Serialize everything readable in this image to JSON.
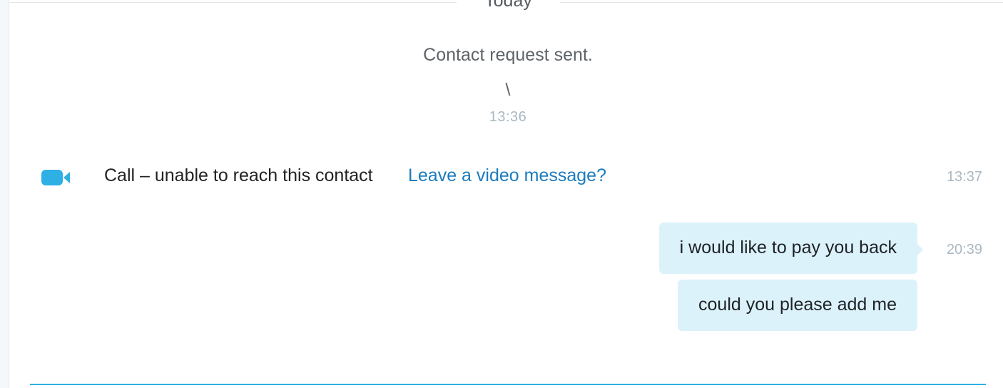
{
  "day_divider": {
    "label": "Today"
  },
  "system_event": {
    "text": "Contact request sent.",
    "sub_text": "\\",
    "time": "13:36"
  },
  "call_event": {
    "icon": "video-camera-icon",
    "text": "Call – unable to reach this contact",
    "link_text": "Leave a video message?",
    "time": "13:37"
  },
  "messages": [
    {
      "text": "i would like to pay you back",
      "time": "20:39"
    },
    {
      "text": "could you please add me"
    }
  ],
  "colors": {
    "accent": "#2eb0e4",
    "bubble": "#dcf2fb",
    "link": "#1a7bbf",
    "timestamp": "#aab8c2"
  }
}
